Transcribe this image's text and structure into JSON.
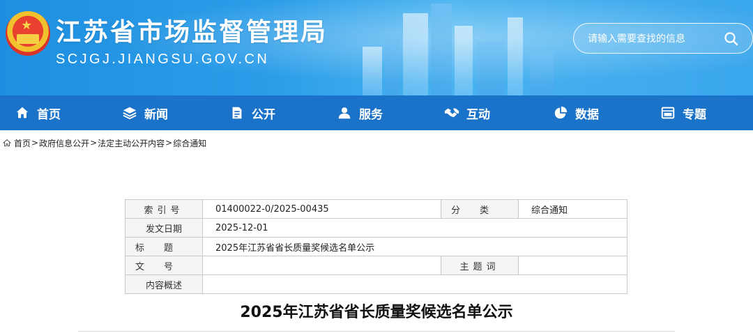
{
  "header": {
    "title": "江苏省市场监督管理局",
    "domain": "SCJGJ.JIANGSU.GOV.CN",
    "search_placeholder": "请输入需要查找的信息",
    "colors": {
      "banner": "#2a9ce8",
      "nav": "#1a73c9"
    }
  },
  "nav": {
    "items": [
      {
        "label": "首页",
        "icon": "home-icon"
      },
      {
        "label": "新闻",
        "icon": "layers-icon"
      },
      {
        "label": "公开",
        "icon": "document-icon"
      },
      {
        "label": "服务",
        "icon": "user-icon"
      },
      {
        "label": "互动",
        "icon": "handshake-icon"
      },
      {
        "label": "数据",
        "icon": "pie-chart-icon"
      },
      {
        "label": "专题",
        "icon": "window-icon"
      }
    ]
  },
  "breadcrumb": [
    "首页",
    "政府信息公开",
    "法定主动公开内容",
    "综合通知"
  ],
  "info": {
    "index_label": "索引号",
    "index_value": "01400022-0/2025-00435",
    "category_label": "分类",
    "category_value": "综合通知",
    "date_label": "发文日期",
    "date_value": "2025-12-01",
    "title_label": "标题",
    "title_value": "2025年江苏省省长质量奖候选名单公示",
    "docno_label": "文号",
    "docno_value": "",
    "subject_label": "主题词",
    "subject_value": "",
    "summary_label": "内容概述",
    "summary_value": ""
  },
  "document": {
    "title": "2025年江苏省省长质量奖候选名单公示"
  }
}
